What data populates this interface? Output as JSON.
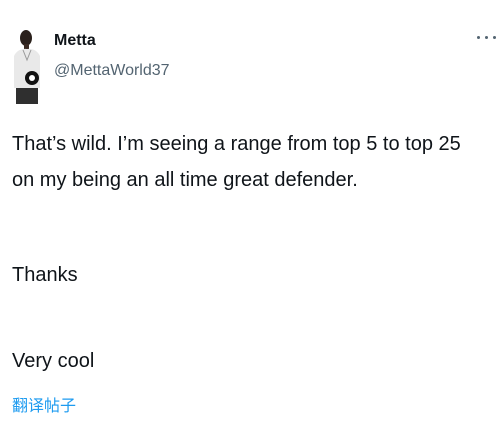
{
  "tweet": {
    "author": {
      "name": "Metta",
      "handle": "@MettaWorld37"
    },
    "paragraphs": [
      "That’s wild. I’m seeing a range from top 5 to top 25 on my being an all time great defender.",
      "Thanks",
      "Very cool"
    ],
    "translate_label": "翻译帖子",
    "more_icon": "more-horizontal-icon"
  }
}
